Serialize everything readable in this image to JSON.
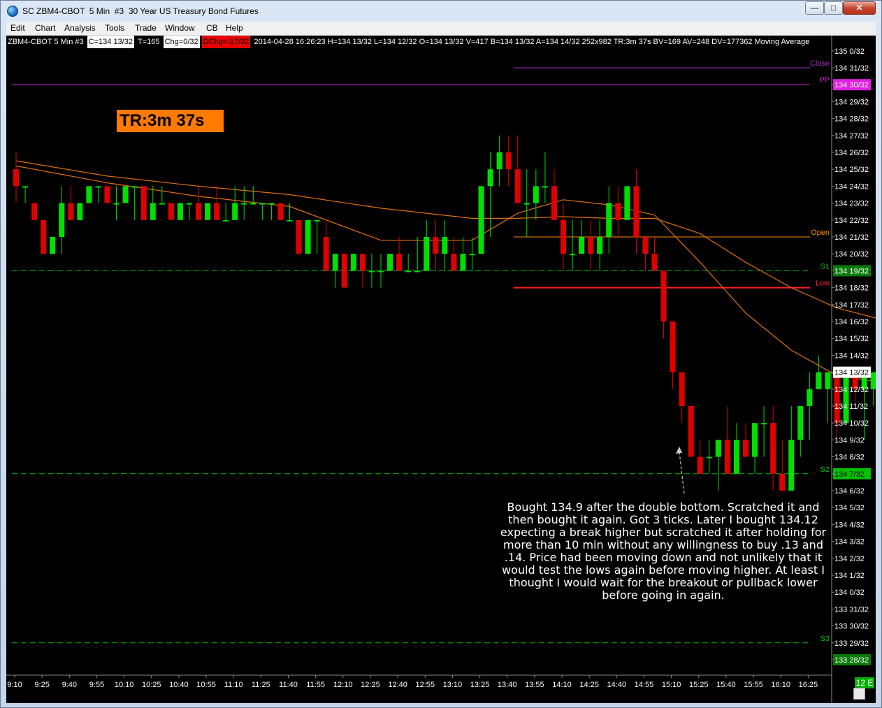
{
  "window": {
    "title": "SC ZBM4-CBOT  5 Min  #3  30 Year US Treasury Bond Futures",
    "min_glyph": "—",
    "max_glyph": "□",
    "close_glyph": "✕"
  },
  "menu": [
    "Edit",
    "Chart",
    "Analysis",
    "Tools",
    "Trade",
    "Window",
    "CB",
    "Help"
  ],
  "infobar": {
    "symbol": "ZBM4-CBOT  5 Min  #3",
    "close": "C=134 13/32",
    "ticks": "T=165",
    "chg": "Chg=0/32",
    "dchg": "DChg=-17/32",
    "rest": "2014-04-28 16:26:23 H=134 13/32 L=134 12/32 O=134 13/32 V=417 B=134 13/32 A=134 14/32 252x982 TR:3m 37s BV=169 AV=248 DV=177362  Moving Average"
  },
  "timer": "TR:3m 37s",
  "annotation": "Bought 134.9 after the double bottom. Scratched it and then bought it again. Got 3 ticks. Later I bought 134.12 expecting a break higher but scratched it after holding for more than 10 min without any willingness to buy .13 and .14. Price had been moving down and not unlikely that it would test the lows again before moving higher. At least I thought I would wait for the breakout or pullback lower before going in again.",
  "scroll_label": "12 E",
  "chart_data": {
    "type": "candlestick",
    "y_unit": "32nds above 134",
    "ylim": [
      -4,
      32
    ],
    "y_tick_labels": [
      "135 0/32",
      "134 31/32",
      "134 30/32",
      "134 29/32",
      "134 28/32",
      "134 27/32",
      "134 26/32",
      "134 25/32",
      "134 24/32",
      "134 23/32",
      "134 22/32",
      "134 21/32",
      "134 20/32",
      "134 19/32",
      "134 18/32",
      "134 17/32",
      "134 16/32",
      "134 15/32",
      "134 14/32",
      "134 13/32",
      "134 12/32",
      "134 11/32",
      "134 10/32",
      "134 9/32",
      "134 8/32",
      "134 7/32",
      "134 6/32",
      "134 5/32",
      "134 4/32",
      "134 3/32",
      "134 2/32",
      "134 1/32",
      "134 0/32",
      "133 31/32",
      "133 30/32",
      "133 29/32",
      "133 28/32"
    ],
    "highlighted_ticks": [
      {
        "label": "134 30/32",
        "bg": "#e020e0",
        "fg": "#ffffff"
      },
      {
        "label": "134 19/32",
        "bg": "#0a7a0a",
        "fg": "#ffffff"
      },
      {
        "label": "134 13/32",
        "bg": "#ffffff",
        "fg": "#000000"
      },
      {
        "label": "134 7/32",
        "bg": "#00c000",
        "fg": "#000000"
      },
      {
        "label": "133 28/32",
        "bg": "#0a7a0a",
        "fg": "#ffffff"
      }
    ],
    "x_labels": [
      "9:10",
      "9:25",
      "9:40",
      "9:55",
      "10:10",
      "10:25",
      "10:40",
      "10:55",
      "11:10",
      "11:25",
      "11:40",
      "11:55",
      "12:10",
      "12:25",
      "12:40",
      "12:55",
      "13:10",
      "13:25",
      "13:40",
      "13:55",
      "14:10",
      "14:25",
      "14:40",
      "14:55",
      "15:10",
      "15:25",
      "15:40",
      "15:55",
      "16:10",
      "16:25"
    ],
    "candles": [
      [
        25,
        26,
        23,
        24
      ],
      [
        24,
        24,
        23,
        24
      ],
      [
        23,
        23,
        22,
        22
      ],
      [
        22,
        22,
        20,
        20
      ],
      [
        20,
        21,
        20,
        21
      ],
      [
        21,
        24,
        20,
        23
      ],
      [
        23,
        24,
        22,
        22
      ],
      [
        22,
        23,
        22,
        23
      ],
      [
        23,
        24,
        23,
        24
      ],
      [
        24,
        24,
        23,
        24
      ],
      [
        24,
        24,
        23,
        23
      ],
      [
        23,
        24,
        22,
        23
      ],
      [
        23,
        24,
        23,
        24
      ],
      [
        24,
        24,
        22,
        24
      ],
      [
        24,
        24,
        22,
        22
      ],
      [
        22,
        24,
        22,
        23
      ],
      [
        23,
        24,
        23,
        23
      ],
      [
        23,
        23,
        22,
        22
      ],
      [
        22,
        23,
        22,
        23
      ],
      [
        23,
        23,
        22,
        23
      ],
      [
        23,
        24,
        22,
        22
      ],
      [
        22,
        23,
        22,
        23
      ],
      [
        23,
        24,
        22,
        22
      ],
      [
        22,
        23,
        22,
        22
      ],
      [
        22,
        24,
        22,
        23
      ],
      [
        23,
        24,
        22,
        23
      ],
      [
        23,
        24,
        23,
        23
      ],
      [
        23,
        23,
        22,
        23
      ],
      [
        23,
        23,
        22,
        23
      ],
      [
        23,
        23,
        22,
        22
      ],
      [
        22,
        23,
        22,
        22
      ],
      [
        22,
        22,
        20,
        20
      ],
      [
        20,
        22,
        20,
        22
      ],
      [
        22,
        22,
        20,
        22
      ],
      [
        21,
        22,
        19,
        19
      ],
      [
        19,
        20,
        18,
        20
      ],
      [
        20,
        20,
        18,
        18
      ],
      [
        19,
        20,
        19,
        20
      ],
      [
        20,
        20,
        18,
        19
      ],
      [
        19,
        20,
        18,
        19
      ],
      [
        19,
        20,
        18,
        19
      ],
      [
        19,
        20,
        19,
        20
      ],
      [
        20,
        21,
        19,
        19
      ],
      [
        19,
        20,
        19,
        19
      ],
      [
        19,
        21,
        19,
        19
      ],
      [
        19,
        22,
        19,
        21
      ],
      [
        21,
        22,
        19,
        20
      ],
      [
        20,
        22,
        19,
        21
      ],
      [
        20,
        21,
        19,
        19
      ],
      [
        19,
        21,
        19,
        20
      ],
      [
        20,
        21,
        19,
        20
      ],
      [
        20,
        24,
        20,
        24
      ],
      [
        24,
        26,
        21,
        25
      ],
      [
        25,
        27,
        24,
        26
      ],
      [
        26,
        27,
        24,
        25
      ],
      [
        25,
        27,
        23,
        23
      ],
      [
        23,
        25,
        21,
        23
      ],
      [
        23,
        25,
        22,
        24
      ],
      [
        24,
        26,
        23,
        24
      ],
      [
        24,
        25,
        22,
        22
      ],
      [
        22,
        23,
        19,
        20
      ],
      [
        20,
        22,
        19,
        20
      ],
      [
        20,
        22,
        20,
        21
      ],
      [
        21,
        22,
        19,
        20
      ],
      [
        20,
        22,
        19,
        21
      ],
      [
        21,
        24,
        20,
        23
      ],
      [
        23,
        24,
        21,
        22
      ],
      [
        22,
        24,
        22,
        24
      ],
      [
        24,
        25,
        20,
        21
      ],
      [
        21,
        21,
        19,
        20
      ],
      [
        20,
        21,
        19,
        19
      ],
      [
        19,
        19,
        15,
        16
      ],
      [
        16,
        16,
        12,
        13
      ],
      [
        13,
        13,
        10,
        11
      ],
      [
        11,
        11,
        8,
        8
      ],
      [
        8,
        9,
        7,
        7
      ],
      [
        8,
        9,
        7,
        8
      ],
      [
        8,
        9,
        6,
        9
      ],
      [
        9,
        11,
        7,
        7
      ],
      [
        7,
        10,
        7,
        9
      ],
      [
        9,
        10,
        8,
        8
      ],
      [
        8,
        10,
        7,
        10
      ],
      [
        10,
        11,
        8,
        10
      ],
      [
        10,
        11,
        6,
        7
      ],
      [
        7,
        9,
        6,
        6
      ],
      [
        6,
        11,
        6,
        9
      ],
      [
        9,
        11,
        8,
        11
      ],
      [
        11,
        13,
        9,
        12
      ],
      [
        12,
        14,
        12,
        13
      ],
      [
        12,
        13,
        10,
        13
      ],
      [
        13,
        13,
        9,
        10
      ],
      [
        10,
        13,
        10,
        13
      ],
      [
        13,
        13,
        11,
        12
      ],
      [
        12,
        13,
        9,
        13
      ],
      [
        12,
        13,
        11,
        13
      ],
      [
        13,
        13,
        12,
        12
      ],
      [
        12,
        13,
        12,
        13
      ],
      [
        13,
        13,
        12,
        12
      ],
      [
        12,
        13,
        11,
        13
      ],
      [
        13,
        13,
        12,
        12
      ],
      [
        12,
        13,
        12,
        13
      ],
      [
        13,
        13,
        12,
        13
      ]
    ],
    "moving_averages": [
      {
        "name": "MA fast",
        "color": "#e07010",
        "points": [
          [
            0,
            25.2
          ],
          [
            10,
            24.2
          ],
          [
            20,
            23.4
          ],
          [
            30,
            22.8
          ],
          [
            40,
            20.8
          ],
          [
            50,
            20.8
          ],
          [
            55,
            22.4
          ],
          [
            60,
            23.2
          ],
          [
            65,
            22.9
          ],
          [
            70,
            22.3
          ],
          [
            75,
            19.5
          ],
          [
            80,
            16.5
          ],
          [
            85,
            14.3
          ],
          [
            90,
            12.8
          ],
          [
            95,
            12.4
          ]
        ]
      },
      {
        "name": "MA slow",
        "color": "#e07010",
        "points": [
          [
            0,
            25.5
          ],
          [
            10,
            24.6
          ],
          [
            20,
            24.0
          ],
          [
            30,
            23.5
          ],
          [
            40,
            22.7
          ],
          [
            50,
            22.1
          ],
          [
            55,
            22.1
          ],
          [
            60,
            22.2
          ],
          [
            65,
            22.1
          ],
          [
            70,
            22.1
          ],
          [
            75,
            21.2
          ],
          [
            80,
            19.5
          ],
          [
            85,
            18.0
          ],
          [
            90,
            16.8
          ],
          [
            95,
            16.1
          ],
          [
            105,
            15.3
          ]
        ]
      }
    ],
    "levels": [
      {
        "label": "Close",
        "value": 31,
        "color": "#a030c0",
        "style": "solid",
        "start": 55
      },
      {
        "label": "PP",
        "value": 30,
        "color": "#e020e0",
        "style": "solid",
        "start": 0
      },
      {
        "label": "Open",
        "value": 21,
        "color": "#ff8c00",
        "style": "solid",
        "start": 55
      },
      {
        "label": "S1",
        "value": 19,
        "color": "#00c000",
        "style": "dashed",
        "start": 0
      },
      {
        "label": "Low",
        "value": 18,
        "color": "#ff2020",
        "style": "solid",
        "start": 55
      },
      {
        "label": "S2",
        "value": 7,
        "color": "#00c000",
        "style": "dashed",
        "start": 0
      },
      {
        "label": "S3",
        "value": -3,
        "color": "#00c000",
        "style": "dashed",
        "start": 0
      }
    ],
    "colors": {
      "up": "#00e000",
      "down": "#e00000",
      "background": "#000000",
      "axis_text": "#ffffff"
    }
  }
}
